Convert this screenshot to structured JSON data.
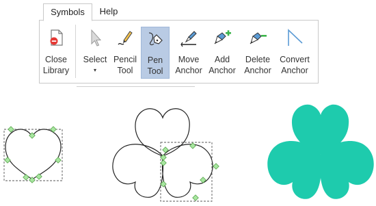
{
  "tabs": [
    {
      "label": "Symbols",
      "active": true
    },
    {
      "label": "Help",
      "active": false
    }
  ],
  "ribbon": {
    "buttons": [
      {
        "id": "close-library",
        "line1": "Close",
        "line2": "Library",
        "icon": "close-library-icon"
      },
      {
        "id": "select",
        "line1": "Select",
        "line2": "",
        "icon": "cursor-arrow-icon",
        "dropdown": "▾"
      },
      {
        "id": "pencil-tool",
        "line1": "Pencil",
        "line2": "Tool",
        "icon": "pencil-icon"
      },
      {
        "id": "pen-tool",
        "line1": "Pen",
        "line2": "Tool",
        "icon": "pen-nib-icon",
        "selected": true
      },
      {
        "id": "move-anchor",
        "line1": "Move",
        "line2": "Anchor",
        "icon": "pen-move-icon"
      },
      {
        "id": "add-anchor",
        "line1": "Add",
        "line2": "Anchor",
        "icon": "pen-plus-icon"
      },
      {
        "id": "delete-anchor",
        "line1": "Delete",
        "line2": "Anchor",
        "icon": "pen-minus-icon"
      },
      {
        "id": "convert-anchor",
        "line1": "Convert",
        "line2": "Anchor",
        "icon": "convert-anchor-icon"
      }
    ]
  },
  "colors": {
    "selected_bg": "#b9cbe4",
    "clover_fill": "#1ecbad",
    "anchor_fill": "#a8e6a0",
    "anchor_stroke": "#5aa54e",
    "add_green": "#3cb44b",
    "delete_red": "#e53935"
  }
}
